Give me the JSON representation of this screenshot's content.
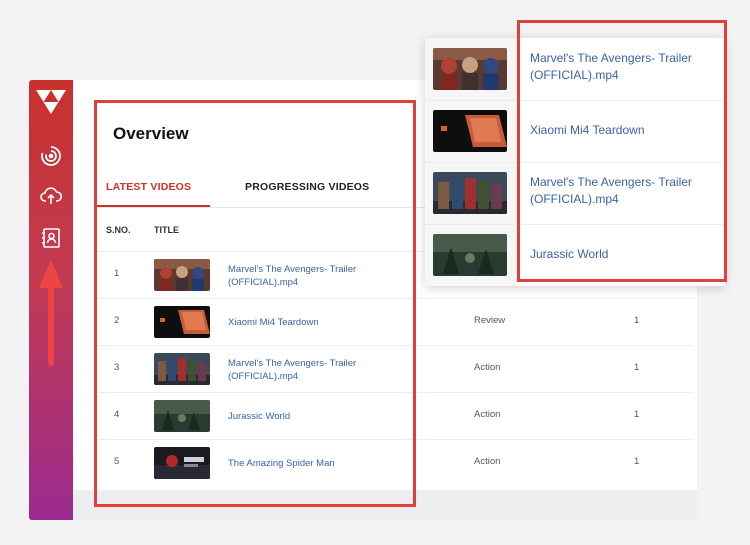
{
  "overview": {
    "title": "Overview",
    "tabs": [
      {
        "label": "LATEST VIDEOS",
        "active": true
      },
      {
        "label": "PROGRESSING VIDEOS",
        "active": false
      }
    ],
    "columns": {
      "sno": "S.NO.",
      "title": "TITLE"
    },
    "rows": [
      {
        "sno": "1",
        "title": "Marvel's The Avengers- Trailer (OFFICIAL).mp4",
        "genre": "",
        "count": "",
        "thumb": "avengers-thumbnail"
      },
      {
        "sno": "2",
        "title": "Xiaomi Mi4 Teardown",
        "genre": "Review",
        "count": "1",
        "thumb": "xiaomi-thumbnail"
      },
      {
        "sno": "3",
        "title": "Marvel's The Avengers- Trailer (OFFICIAL).mp4",
        "genre": "Action",
        "count": "1",
        "thumb": "avengers-group-thumbnail"
      },
      {
        "sno": "4",
        "title": "Jurassic World",
        "genre": "Action",
        "count": "1",
        "thumb": "jurassic-world-thumbnail"
      },
      {
        "sno": "5",
        "title": "The Amazing Spider Man",
        "genre": "Action",
        "count": "1",
        "thumb": "spiderman-thumbnail"
      }
    ]
  },
  "popup": {
    "items": [
      {
        "title": "Marvel's The Avengers- Trailer (OFFICIAL).mp4",
        "thumb": "avengers-thumbnail"
      },
      {
        "title": "Xiaomi Mi4 Teardown",
        "thumb": "xiaomi-thumbnail"
      },
      {
        "title": "Marvel's The Avengers- Trailer (OFFICIAL).mp4",
        "thumb": "avengers-group-thumbnail"
      },
      {
        "title": "Jurassic World",
        "thumb": "jurassic-world-thumbnail"
      }
    ]
  },
  "sidebar": {
    "icons": [
      "logo-icon",
      "progress-spinner-icon",
      "cloud-upload-icon",
      "contacts-icon"
    ],
    "accent_top": "#c8312c",
    "accent_bottom": "#9b2b8e"
  },
  "colors": {
    "accent": "#d0302a",
    "link": "#3a62a8",
    "annotation": "#e0403c"
  }
}
